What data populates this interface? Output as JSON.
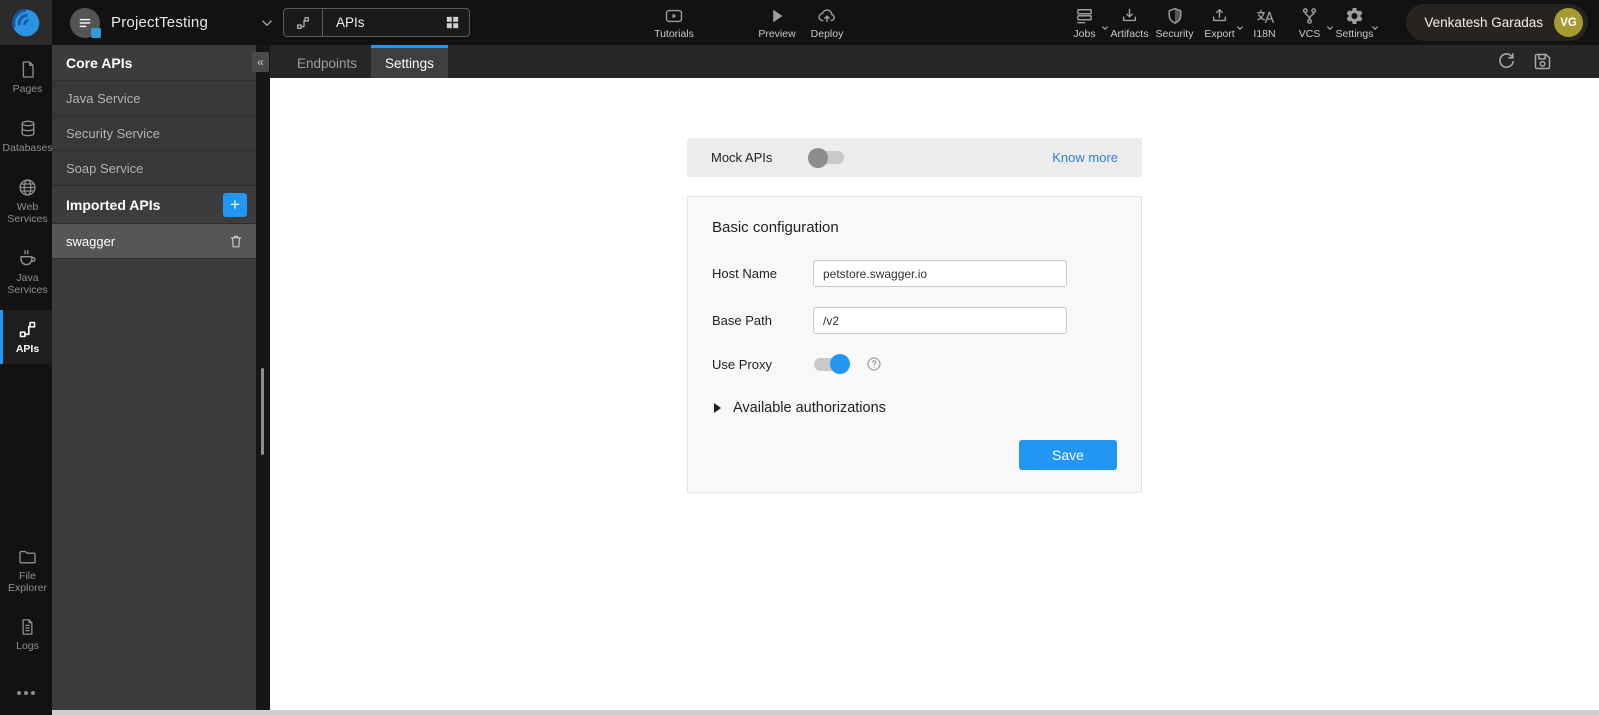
{
  "topbar": {
    "project": {
      "name": "ProjectTesting"
    },
    "selector": {
      "label": "APIs"
    },
    "center_actions": [
      {
        "label": "Tutorials",
        "icon": "tutorials-icon"
      },
      {
        "label": "Preview",
        "icon": "preview-icon"
      },
      {
        "label": "Deploy",
        "icon": "deploy-icon"
      }
    ],
    "right_actions": [
      {
        "label": "Jobs",
        "icon": "jobs-icon",
        "has_caret": true
      },
      {
        "label": "Artifacts",
        "icon": "artifacts-icon",
        "has_caret": false
      },
      {
        "label": "Security",
        "icon": "security-icon",
        "has_caret": false
      },
      {
        "label": "Export",
        "icon": "export-icon",
        "has_caret": true
      },
      {
        "label": "I18N",
        "icon": "i18n-icon",
        "has_caret": false
      },
      {
        "label": "VCS",
        "icon": "vcs-icon",
        "has_caret": true
      },
      {
        "label": "Settings",
        "icon": "settings-icon",
        "has_caret": true
      }
    ],
    "user": {
      "name": "Venkatesh Garadas",
      "initials": "VG"
    }
  },
  "sidebar": {
    "items": [
      {
        "label": "Pages",
        "icon": "pages-icon",
        "active": false
      },
      {
        "label": "Databases",
        "icon": "databases-icon",
        "active": false
      },
      {
        "label": "Web Services",
        "icon": "globe-icon",
        "active": false
      },
      {
        "label": "Java Services",
        "icon": "coffee-icon",
        "active": false
      },
      {
        "label": "APIs",
        "icon": "api-flow-icon",
        "active": true
      },
      {
        "label": "File Explorer",
        "icon": "folder-icon",
        "active": false
      },
      {
        "label": "Logs",
        "icon": "logs-icon",
        "active": false
      }
    ]
  },
  "panel": {
    "core_header": "Core APIs",
    "collapse_glyph": "«",
    "core_items": [
      {
        "label": "Java Service"
      },
      {
        "label": "Security Service"
      },
      {
        "label": "Soap Service"
      }
    ],
    "imported_header": "Imported APIs",
    "imported_items": [
      {
        "label": "swagger",
        "selected": true
      }
    ]
  },
  "tabs": [
    {
      "label": "Endpoints",
      "active": false
    },
    {
      "label": "Settings",
      "active": true
    }
  ],
  "settings_page": {
    "mock": {
      "label": "Mock APIs",
      "state": "off",
      "link_label": "Know more"
    },
    "basic": {
      "title": "Basic configuration",
      "host": {
        "label": "Host Name",
        "value": "petstore.swagger.io"
      },
      "base_path": {
        "label": "Base Path",
        "value": "/v2"
      },
      "proxy": {
        "label": "Use Proxy",
        "state": "on"
      },
      "authorizations": {
        "label": "Available authorizations"
      },
      "save_label": "Save"
    }
  },
  "colors": {
    "accent": "#2196f3",
    "link": "#2a7de2",
    "avatar": "#a89a33"
  }
}
